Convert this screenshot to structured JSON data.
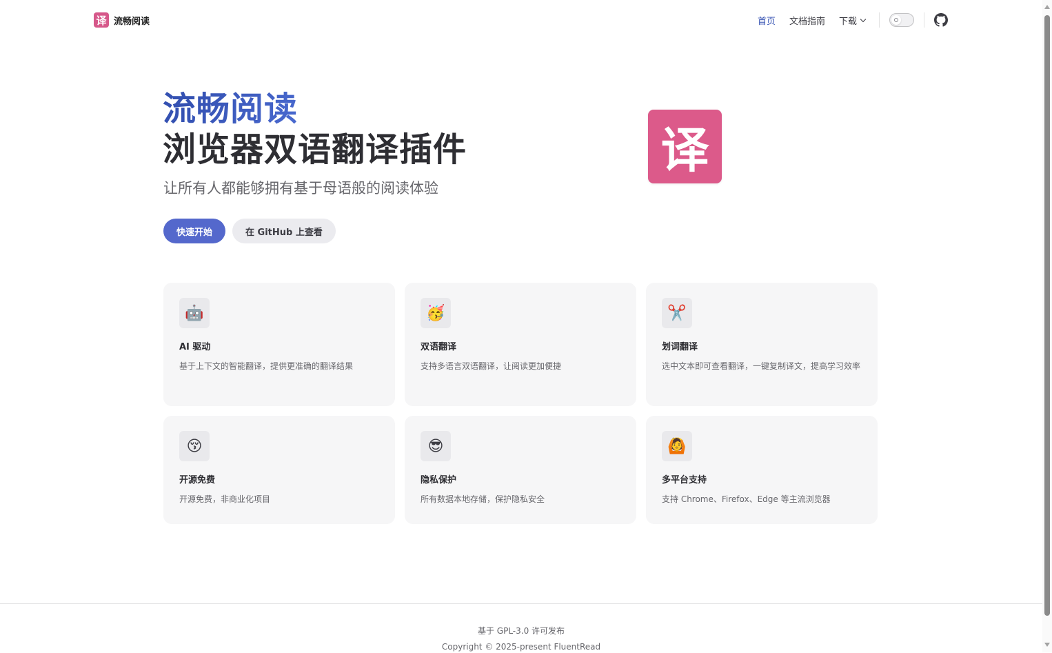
{
  "nav": {
    "logo_glyph": "译",
    "brand": "流畅阅读",
    "links": [
      {
        "label": "首页",
        "active": true
      },
      {
        "label": "文档指南",
        "active": false
      }
    ],
    "download_label": "下载",
    "theme_toggle_icon": "sun-icon",
    "github_icon": "github-icon"
  },
  "hero": {
    "name": "流畅阅读",
    "text": "浏览器双语翻译插件",
    "tagline": "让所有人都能够拥有基于母语般的阅读体验",
    "actions": {
      "primary": "快速开始",
      "alt": "在 GitHub 上查看"
    },
    "image_glyph": "译"
  },
  "features": [
    {
      "icon": "🤖",
      "icon_name": "robot-icon",
      "title": "AI 驱动",
      "details": "基于上下文的智能翻译，提供更准确的翻译结果"
    },
    {
      "icon": "🥳",
      "icon_name": "party-face-icon",
      "title": "双语翻译",
      "details": "支持多语言双语翻译，让阅读更加便捷"
    },
    {
      "icon": "✂️",
      "icon_name": "scissors-icon",
      "title": "划词翻译",
      "details": "选中文本即可查看翻译，一键复制译文，提高学习效率"
    },
    {
      "icon": "😚",
      "icon_name": "kissing-face-icon",
      "title": "开源免费",
      "details": "开源免费，非商业化项目"
    },
    {
      "icon": "😎",
      "icon_name": "sunglasses-face-icon",
      "title": "隐私保护",
      "details": "所有数据本地存储，保护隐私安全"
    },
    {
      "icon": "🙆",
      "icon_name": "person-gesturing-icon",
      "title": "多平台支持",
      "details": "支持 Chrome、Firefox、Edge 等主流浏览器"
    }
  ],
  "footer": {
    "message": "基于 GPL-3.0 许可发布",
    "copyright": "Copyright © 2025-present FluentRead"
  },
  "colors": {
    "brand": "#3451b2",
    "primary_button": "#5468cc",
    "logo_bg": "#dc5a8a"
  }
}
